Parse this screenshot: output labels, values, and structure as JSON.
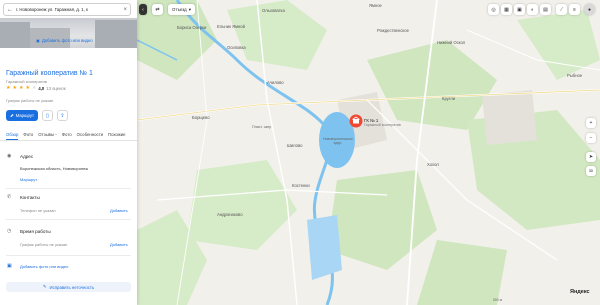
{
  "search": {
    "query": "г. Нововоронеж ул. Гаражная, д. 1, к"
  },
  "place": {
    "add_photo_top": "Добавить фото или видео",
    "title": "Гаражный кооператив № 1",
    "category": "Гаражный кооператив",
    "rating_score": "4,0",
    "rating_count": "13 оценок",
    "hours_summary": "График работы не указан",
    "route_label": "Маршрут"
  },
  "tabs": [
    "Обзор",
    "Фото",
    "Отзывы",
    "Фото",
    "Особенности",
    "Похожие"
  ],
  "address": {
    "title": "Адрес",
    "text": "Воронежская область, Нововоронеж",
    "route_link": "Маршрут"
  },
  "contacts": {
    "title": "Контакты",
    "phone_placeholder": "Телефон не указан",
    "add_link": "Добавить"
  },
  "hours": {
    "title": "Время работы",
    "text": "График работы не указан",
    "add_link": "Добавить"
  },
  "add_photo_bottom": "Добавить фото или видео",
  "edit_label": "Исправить неточность",
  "map": {
    "traffic_label": "Отъезд",
    "pin_name": "ГК № 1",
    "pin_category": "Гаражный кооператив",
    "reservoir_label": "Нововоронежское вдхр.",
    "logo": "Яндекс",
    "labels": {
      "l1": "Ольховатка",
      "l2": "Ямное",
      "l3": "Ельник Ямной",
      "l4": "Рождественское",
      "l5": "Осиповка",
      "l6": "Ачилово",
      "l7": "Борщево",
      "l8": "Шилово",
      "l9": "Кругли",
      "l10": "Рыбное",
      "l11": "Андронаково",
      "l12": "Хохол",
      "l13": "Костенки",
      "l14": "Нижний Оскол",
      "l15": "Бориса Озерки",
      "l16": "Пласт. озер"
    },
    "scale_text": "500 м",
    "colors": {
      "water": "#7ec3f0",
      "forest": "#cfe6bf",
      "road": "#fff",
      "pin": "#f0472f",
      "accent": "#1a6fe0"
    }
  }
}
